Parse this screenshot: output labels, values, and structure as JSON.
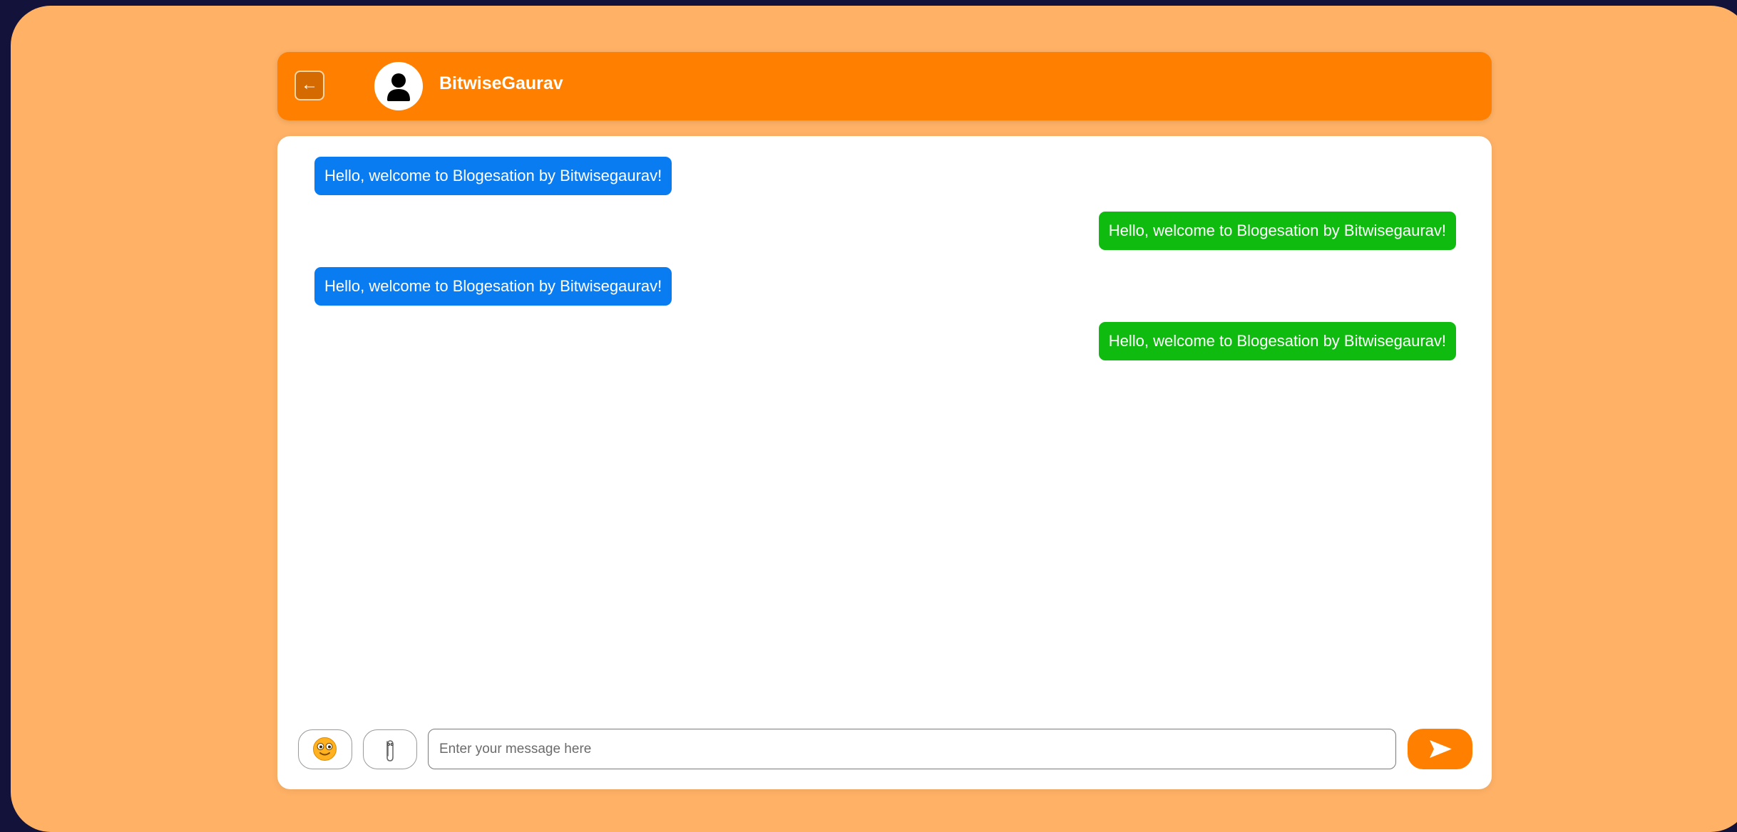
{
  "header": {
    "back_glyph": "←",
    "contact_name": "BitwiseGaurav",
    "avatar_icon": "user-silhouette-icon"
  },
  "messages": [
    {
      "direction": "received",
      "text": "Hello, welcome to Blogesation by Bitwisegaurav!"
    },
    {
      "direction": "sent",
      "text": "Hello, welcome to Blogesation by Bitwisegaurav!"
    },
    {
      "direction": "received",
      "text": "Hello, welcome to Blogesation by Bitwisegaurav!"
    },
    {
      "direction": "sent",
      "text": "Hello, welcome to Blogesation by Bitwisegaurav!"
    }
  ],
  "composer": {
    "emoji_icon": "emoji-face-icon",
    "attach_icon": "paperclip-icon",
    "input_value": "",
    "input_placeholder": "Enter your message here",
    "send_icon": "send-arrow-icon"
  },
  "colors": {
    "page_background": "#ffb266",
    "header_background": "#ff8000",
    "received_bubble": "#0a7cf2",
    "sent_bubble": "#10bb10",
    "send_button": "#ff8000"
  }
}
